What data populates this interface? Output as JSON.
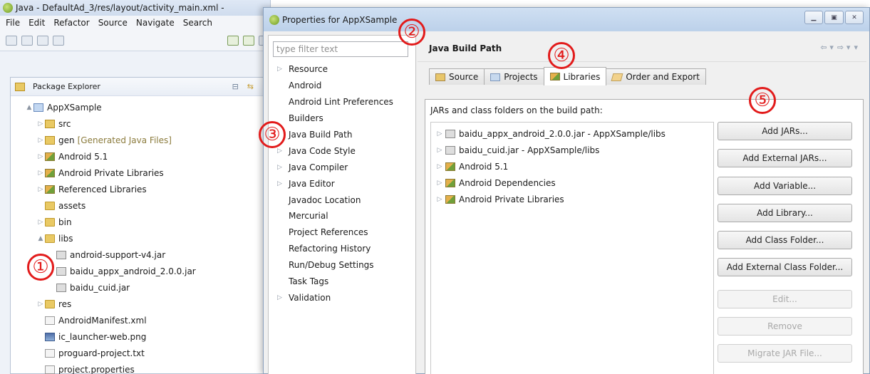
{
  "eclipse": {
    "title": "Java - DefaultAd_3/res/layout/activity_main.xml -",
    "menu": [
      "File",
      "Edit",
      "Refactor",
      "Source",
      "Navigate",
      "Search"
    ],
    "package_explorer_title": "Package Explorer",
    "tree": [
      {
        "label": "AppXSample",
        "icon": "project-icon",
        "level": 0,
        "arrow": "▲"
      },
      {
        "label": "src",
        "icon": "package-folder-icon",
        "level": 1,
        "arrow": "▷"
      },
      {
        "label": "gen",
        "suffix": "[Generated Java Files]",
        "icon": "package-folder-icon",
        "level": 1,
        "arrow": "▷"
      },
      {
        "label": "Android 5.1",
        "icon": "library-icon",
        "level": 1,
        "arrow": "▷"
      },
      {
        "label": "Android Private Libraries",
        "icon": "library-icon",
        "level": 1,
        "arrow": "▷"
      },
      {
        "label": "Referenced Libraries",
        "icon": "library-icon",
        "level": 1,
        "arrow": "▷"
      },
      {
        "label": "assets",
        "icon": "folder-icon",
        "level": 1,
        "arrow": ""
      },
      {
        "label": "bin",
        "icon": "folder-icon",
        "level": 1,
        "arrow": "▷"
      },
      {
        "label": "libs",
        "icon": "folder-icon",
        "level": 1,
        "arrow": "▲"
      },
      {
        "label": "android-support-v4.jar",
        "icon": "jar-icon",
        "level": 2,
        "arrow": ""
      },
      {
        "label": "baidu_appx_android_2.0.0.jar",
        "icon": "jar-icon",
        "level": 2,
        "arrow": ""
      },
      {
        "label": "baidu_cuid.jar",
        "icon": "jar-icon",
        "level": 2,
        "arrow": ""
      },
      {
        "label": "res",
        "icon": "folder-icon",
        "level": 1,
        "arrow": "▷"
      },
      {
        "label": "AndroidManifest.xml",
        "icon": "file-icon",
        "level": 1,
        "arrow": ""
      },
      {
        "label": "ic_launcher-web.png",
        "icon": "image-icon",
        "level": 1,
        "arrow": ""
      },
      {
        "label": "proguard-project.txt",
        "icon": "file-icon",
        "level": 1,
        "arrow": ""
      },
      {
        "label": "project.properties",
        "icon": "file-icon",
        "level": 1,
        "arrow": ""
      }
    ]
  },
  "dialog": {
    "title": "Properties for AppXSample",
    "filter_placeholder": "type filter text",
    "nav": [
      {
        "label": "Resource",
        "expandable": true
      },
      {
        "label": "Android",
        "expandable": false
      },
      {
        "label": "Android Lint Preferences",
        "expandable": false
      },
      {
        "label": "Builders",
        "expandable": false
      },
      {
        "label": "Java Build Path",
        "expandable": false
      },
      {
        "label": "Java Code Style",
        "expandable": true
      },
      {
        "label": "Java Compiler",
        "expandable": true
      },
      {
        "label": "Java Editor",
        "expandable": true
      },
      {
        "label": "Javadoc Location",
        "expandable": false
      },
      {
        "label": "Mercurial",
        "expandable": false
      },
      {
        "label": "Project References",
        "expandable": false
      },
      {
        "label": "Refactoring History",
        "expandable": false
      },
      {
        "label": "Run/Debug Settings",
        "expandable": false
      },
      {
        "label": "Task Tags",
        "expandable": false
      },
      {
        "label": "Validation",
        "expandable": true
      }
    ],
    "section_title": "Java Build Path",
    "tabs": [
      {
        "label": "Source",
        "icon": "source-icon"
      },
      {
        "label": "Projects",
        "icon": "projects-icon"
      },
      {
        "label": "Libraries",
        "icon": "libraries-icon",
        "active": true
      },
      {
        "label": "Order and Export",
        "icon": "order-icon"
      }
    ],
    "jars_label": "JARs and class folders on the build path:",
    "jars": [
      {
        "label": "baidu_appx_android_2.0.0.jar - AppXSample/libs",
        "icon": "jar-icon"
      },
      {
        "label": "baidu_cuid.jar - AppXSample/libs",
        "icon": "jar-icon"
      },
      {
        "label": "Android 5.1",
        "icon": "library-icon"
      },
      {
        "label": "Android Dependencies",
        "icon": "library-icon"
      },
      {
        "label": "Android Private Libraries",
        "icon": "library-icon"
      }
    ],
    "buttons": [
      {
        "label": "Add JARs...",
        "enabled": true
      },
      {
        "label": "Add External JARs...",
        "enabled": true
      },
      {
        "label": "Add Variable...",
        "enabled": true
      },
      {
        "label": "Add Library...",
        "enabled": true
      },
      {
        "label": "Add Class Folder...",
        "enabled": true
      },
      {
        "label": "Add External Class Folder...",
        "enabled": true
      },
      {
        "label": "Edit...",
        "enabled": false
      },
      {
        "label": "Remove",
        "enabled": false
      },
      {
        "label": "Migrate JAR File...",
        "enabled": false
      }
    ]
  },
  "callouts": [
    "①",
    "②",
    "③",
    "④",
    "⑤"
  ],
  "colors": {
    "callout": "#e21b1b",
    "dialog_bg": "#f0f0f0",
    "title_bar": "#c5d8ef"
  }
}
